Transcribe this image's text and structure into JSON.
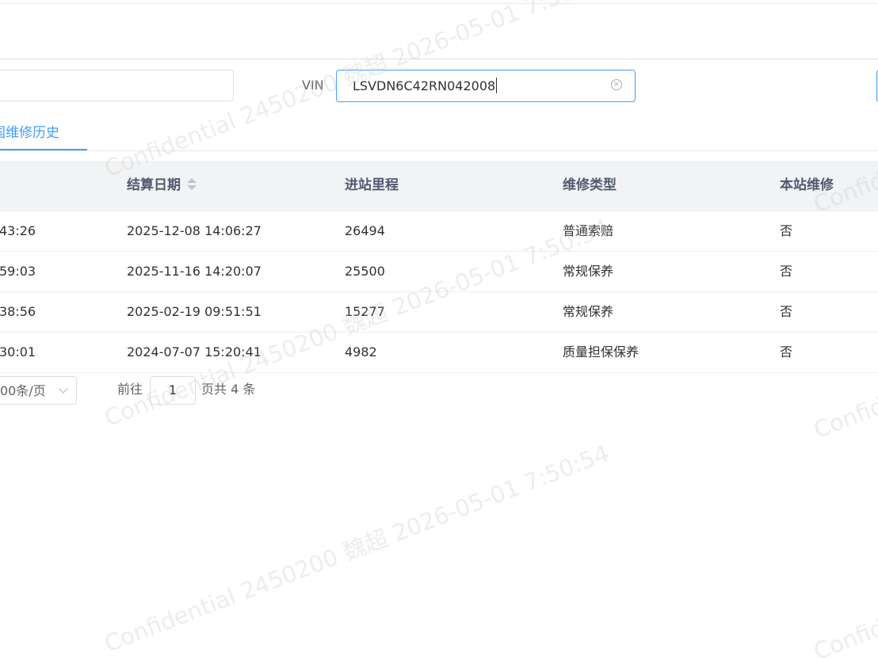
{
  "search": {
    "vin_label": "VIN",
    "vin_value": "LSVDN6C42RN042008"
  },
  "tabs": [
    {
      "label": "全国维修历史",
      "visible_label": "国维修历史"
    }
  ],
  "table": {
    "headers": {
      "settle_date": "结算日期",
      "mileage": "进站里程",
      "repair_type": "维修类型",
      "local_repair": "本站维修"
    },
    "rows": [
      {
        "prev_time": "43:26",
        "settle_date": "2025-12-08 14:06:27",
        "mileage": "26494",
        "repair_type": "普通索赔",
        "local_repair": "否"
      },
      {
        "prev_time": "59:03",
        "settle_date": "2025-11-16 14:20:07",
        "mileage": "25500",
        "repair_type": "常规保养",
        "local_repair": "否"
      },
      {
        "prev_time": "38:56",
        "settle_date": "2025-02-19 09:51:51",
        "mileage": "15277",
        "repair_type": "常规保养",
        "local_repair": "否"
      },
      {
        "prev_time": "30:01",
        "settle_date": "2024-07-07 15:20:41",
        "mileage": "4982",
        "repair_type": "质量担保保养",
        "local_repair": "否"
      }
    ]
  },
  "pagination": {
    "page_size_label": "00条/页",
    "goto_label": "前往",
    "current_page": "1",
    "suffix": "页共 4 条"
  },
  "watermark_text": "Confidential 2450200 魏超 2026-05-01 7:50:54",
  "colors": {
    "accent": "#409eff",
    "header_bg": "#f2f3f5",
    "border": "#dcdfe6"
  }
}
